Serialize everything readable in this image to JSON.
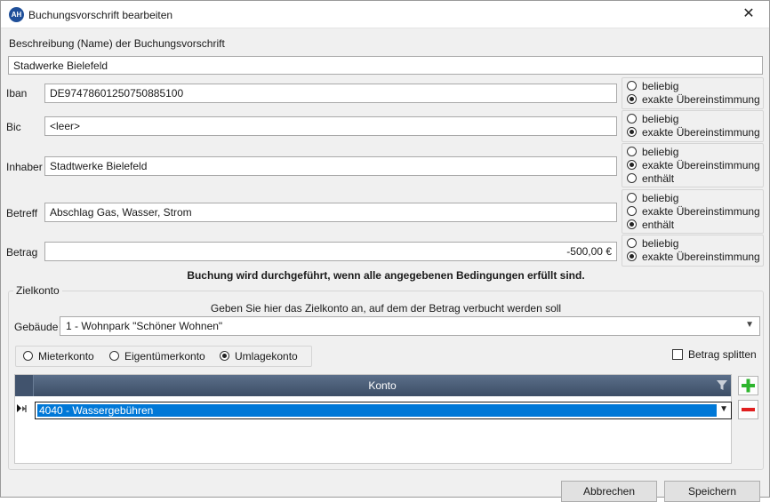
{
  "window": {
    "title": "Buchungsvorschrift bearbeiten",
    "app_icon": "AH",
    "close_glyph": "✕"
  },
  "description": {
    "label": "Beschreibung (Name) der Buchungsvorschrift",
    "value": "Stadwerke Bielefeld"
  },
  "conditions": {
    "iban": {
      "label": "Iban",
      "value": "DE97478601250750885100",
      "options": [
        {
          "label": "beliebig",
          "checked": false
        },
        {
          "label": "exakte Übereinstimmung",
          "checked": true
        }
      ]
    },
    "bic": {
      "label": "Bic",
      "value": "<leer>",
      "options": [
        {
          "label": "beliebig",
          "checked": false
        },
        {
          "label": "exakte Übereinstimmung",
          "checked": true
        }
      ]
    },
    "inhaber": {
      "label": "Inhaber",
      "value": "Stadtwerke Bielefeld",
      "options": [
        {
          "label": "beliebig",
          "checked": false
        },
        {
          "label": "exakte Übereinstimmung",
          "checked": true
        },
        {
          "label": "enthält",
          "checked": false
        }
      ]
    },
    "betreff": {
      "label": "Betreff",
      "value": "Abschlag Gas, Wasser, Strom",
      "options": [
        {
          "label": "beliebig",
          "checked": false
        },
        {
          "label": "exakte Übereinstimmung",
          "checked": false
        },
        {
          "label": "enthält",
          "checked": true
        }
      ]
    },
    "betrag": {
      "label": "Betrag",
      "value": "-500,00 €",
      "options": [
        {
          "label": "beliebig",
          "checked": false
        },
        {
          "label": "exakte Übereinstimmung",
          "checked": true
        }
      ]
    }
  },
  "info_text": "Buchung wird durchgeführt, wenn alle angegebenen Bedingungen erfüllt sind.",
  "zielkonto": {
    "group_title": "Zielkonto",
    "hint": "Geben Sie hier das Zielkonto an, auf dem der Betrag verbucht werden soll",
    "gebaeude_label": "Gebäude",
    "gebaeude_value": "1 - Wohnpark \"Schöner Wohnen\"",
    "account_types": [
      {
        "label": "Mieterkonto",
        "checked": false
      },
      {
        "label": "Eigentümerkonto",
        "checked": false
      },
      {
        "label": "Umlagekonto",
        "checked": true
      }
    ],
    "split_label": "Betrag splitten",
    "split_checked": false,
    "grid_header": "Konto",
    "rows": [
      "4040 - Wassergebühren"
    ]
  },
  "buttons": {
    "cancel": "Abbrechen",
    "save": "Speichern"
  },
  "colors": {
    "selection": "#0078d7",
    "grid_header": "#4a5c76",
    "add": "#2db52d",
    "remove": "#e01e1e"
  }
}
